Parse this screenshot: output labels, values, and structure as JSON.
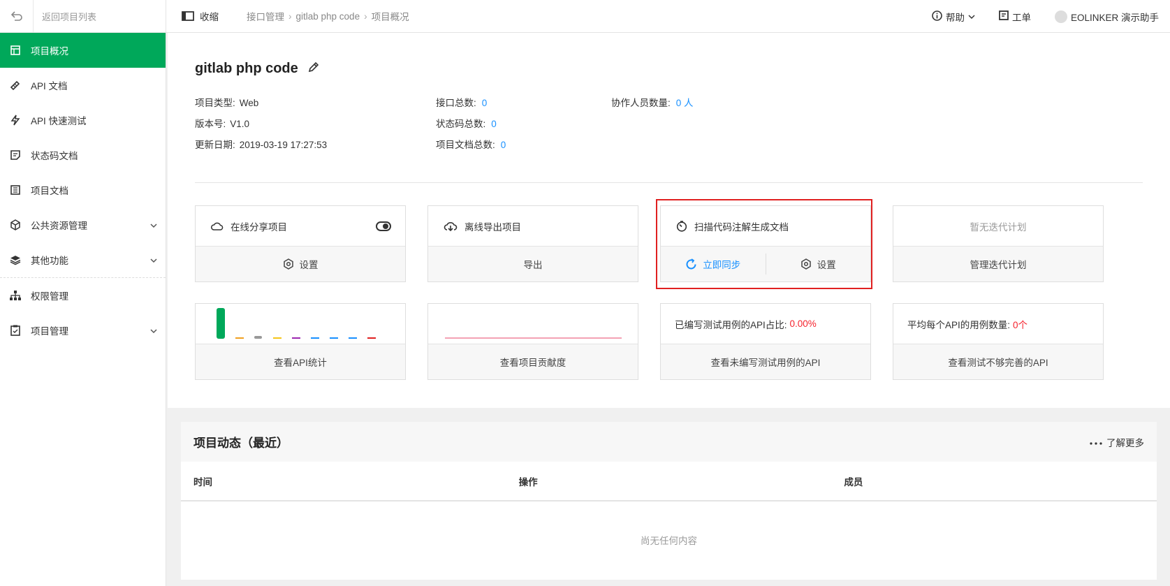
{
  "sidebar": {
    "back_label": "返回项目列表",
    "items": [
      {
        "label": "项目概况",
        "icon": "overview-icon",
        "active": true
      },
      {
        "label": "API 文档",
        "icon": "api-doc-icon"
      },
      {
        "label": "API 快速测试",
        "icon": "lightning-icon"
      },
      {
        "label": "状态码文档",
        "icon": "status-code-icon"
      },
      {
        "label": "项目文档",
        "icon": "document-icon"
      },
      {
        "label": "公共资源管理",
        "icon": "cube-icon",
        "expandable": true
      },
      {
        "label": "其他功能",
        "icon": "layers-icon",
        "expandable": true
      },
      {
        "label": "权限管理",
        "icon": "org-chart-icon"
      },
      {
        "label": "项目管理",
        "icon": "clipboard-icon",
        "expandable": true
      }
    ]
  },
  "topbar": {
    "collapse_label": "收缩",
    "breadcrumb": [
      "接口管理",
      "gitlab php code",
      "项目概况"
    ],
    "help_label": "帮助",
    "ticket_label": "工单",
    "user_label": "EOLINKER 演示助手"
  },
  "project": {
    "name": "gitlab php code",
    "type_label": "项目类型:",
    "type_value": "Web",
    "version_label": "版本号:",
    "version_value": "V1.0",
    "updated_label": "更新日期:",
    "updated_value": "2019-03-19 17:27:53",
    "api_total_label": "接口总数:",
    "api_total_value": "0",
    "status_total_label": "状态码总数:",
    "status_total_value": "0",
    "doc_total_label": "项目文档总数:",
    "doc_total_value": "0",
    "members_label": "协作人员数量:",
    "members_value": "0 人"
  },
  "cards": {
    "share": {
      "title": "在线分享项目",
      "action": "设置"
    },
    "export": {
      "title": "离线导出项目",
      "action": "导出"
    },
    "scan": {
      "title": "扫描代码注解生成文档",
      "sync": "立即同步",
      "settings": "设置"
    },
    "iteration": {
      "title": "暂无迭代计划",
      "action": "管理迭代计划"
    },
    "api_stats": {
      "action": "查看API统计"
    },
    "contribution": {
      "action": "查看项目贡献度"
    },
    "test_ratio": {
      "label": "已编写测试用例的API占比:",
      "value": "0.00%",
      "action": "查看未编写测试用例的API"
    },
    "avg_cases": {
      "label": "平均每个API的用例数量:",
      "value": "0个",
      "action": "查看测试不够完善的API"
    }
  },
  "mini_bars": {
    "colors": [
      "#00a85a",
      "#f0a020",
      "#999999",
      "#f5c518",
      "#9c27b0",
      "#1890ff",
      "#1890ff",
      "#1890ff",
      "#e02020"
    ]
  },
  "activity": {
    "title": "项目动态（最近）",
    "more_label": "了解更多",
    "columns": [
      "时间",
      "操作",
      "成员"
    ],
    "empty_text": "尚无任何内容"
  },
  "colors": {
    "primary": "#00a85a",
    "link": "#1890ff",
    "danger": "#f5222d"
  }
}
